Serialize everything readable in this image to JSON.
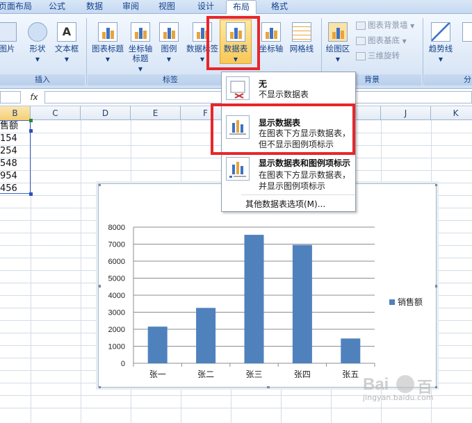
{
  "ribbon": {
    "tabs": [
      {
        "label": "页面布局",
        "active": false
      },
      {
        "label": "公式",
        "active": false
      },
      {
        "label": "数据",
        "active": false
      },
      {
        "label": "审阅",
        "active": false
      },
      {
        "label": "视图",
        "active": false
      },
      {
        "label": "设计",
        "active": false
      },
      {
        "label": "布局",
        "active": true
      },
      {
        "label": "格式",
        "active": false
      }
    ],
    "groups": {
      "insert": {
        "label": "插入",
        "buttons": [
          "图片",
          "形状",
          "文本框"
        ]
      },
      "labels": {
        "label": "标签",
        "buttons": [
          "图表标题",
          "坐标轴标题",
          "图例",
          "数据标签",
          "数据表"
        ]
      },
      "axes": {
        "buttons": [
          "坐标轴",
          "网格线"
        ]
      },
      "background": {
        "label": "背景",
        "main_button": "绘图区",
        "small_buttons": [
          "图表背景墙",
          "图表基底",
          "三维旋转"
        ]
      },
      "analysis": {
        "label": "分",
        "buttons": [
          "趋势线"
        ]
      }
    }
  },
  "formula_bar": {
    "fx": "fx"
  },
  "sheet": {
    "columns": [
      "B",
      "C",
      "D",
      "E",
      "F",
      "G",
      "H",
      "I",
      "J",
      "K"
    ],
    "column_b_values": [
      "售额",
      "154",
      "254",
      "548",
      "954",
      "456"
    ]
  },
  "dropdown": {
    "items": [
      {
        "title": "无",
        "desc": [
          "不显示数据表"
        ]
      },
      {
        "title": "显示数据表",
        "desc": [
          "在图表下方显示数据表，",
          "但不显示图例项标示"
        ]
      },
      {
        "title": "显示数据表和图例项标示",
        "desc": [
          "在图表下方显示数据表，",
          "并显示图例项标示"
        ]
      }
    ],
    "more_options": "其他数据表选项(M)..."
  },
  "chart_data": {
    "type": "bar",
    "categories": [
      "张一",
      "张二",
      "张三",
      "张四",
      "张五"
    ],
    "series": [
      {
        "name": "销售额",
        "values": [
          2154,
          3254,
          7548,
          6954,
          1456
        ]
      }
    ],
    "ylim": [
      0,
      8000
    ],
    "yticks": [
      0,
      1000,
      2000,
      3000,
      4000,
      5000,
      6000,
      7000,
      8000
    ],
    "grid": true,
    "legend": "right",
    "color": "#4f81bd"
  },
  "watermark": {
    "text": "Bai",
    "text2": "百",
    "sub": "jingyan.baidu.com"
  }
}
